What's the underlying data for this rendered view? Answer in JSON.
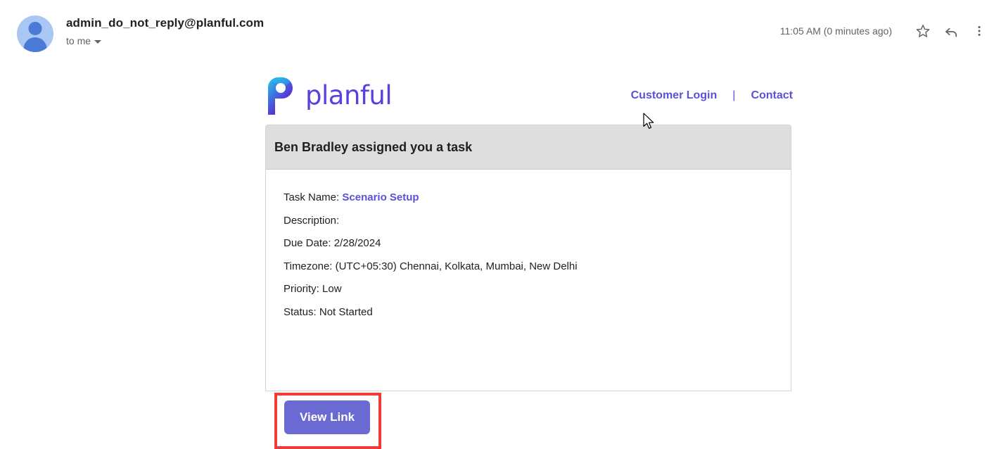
{
  "mail": {
    "sender_email": "admin_do_not_reply@planful.com",
    "recipient_label": "to me",
    "timestamp": "11:05 AM (0 minutes ago)",
    "avatar_name": "avatar",
    "icons": {
      "star": "star-icon",
      "reply": "reply-icon",
      "more": "more-options-icon",
      "caret": "chevron-down-icon"
    }
  },
  "brand": {
    "wordmark": "planful",
    "logo_name": "planful-logo",
    "customer_login": "Customer Login",
    "separator": "|",
    "contact": "Contact",
    "colors": {
      "wordmark": "#5b3fe0",
      "link": "#5b51d8",
      "logo_cyan": "#29b6e8",
      "logo_purple": "#5b2fd0"
    }
  },
  "card": {
    "title": "Ben Bradley assigned you a task",
    "header_bg": "#dededf",
    "details": [
      {
        "label": "Task Name:",
        "value": "Scenario Setup",
        "is_link": true
      },
      {
        "label": "Description:",
        "value": "",
        "is_link": false
      },
      {
        "label": "Due Date:",
        "value": "2/28/2024",
        "is_link": false
      },
      {
        "label": "Timezone:",
        "value": "(UTC+05:30) Chennai, Kolkata, Mumbai, New Delhi",
        "is_link": false
      },
      {
        "label": "Priority:",
        "value": "Low",
        "is_link": false
      },
      {
        "label": "Status:",
        "value": "Not Started",
        "is_link": false
      }
    ],
    "button_label": "View Link",
    "button_color": "#6a6ad2",
    "annotation_color": "#f23a36"
  }
}
